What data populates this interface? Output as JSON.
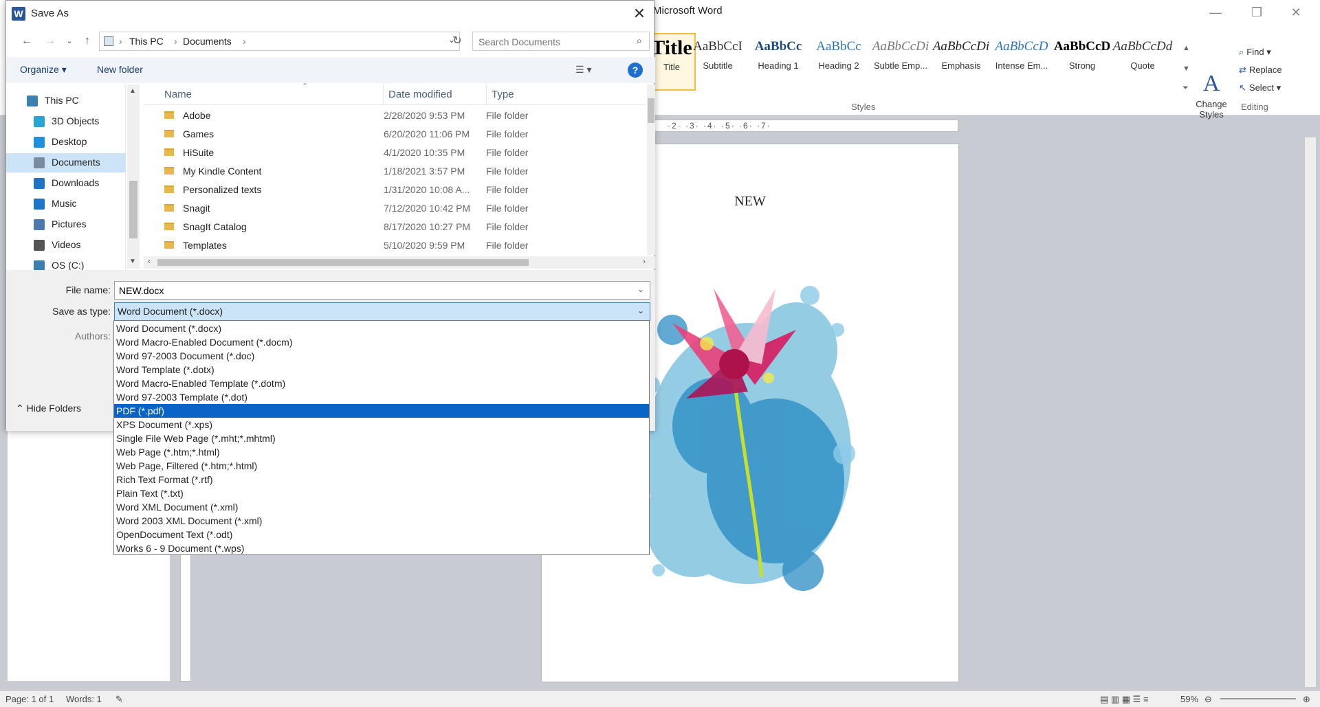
{
  "word": {
    "window_title": "Microsoft Word",
    "styles": [
      {
        "sample": "Title",
        "name": "Title"
      },
      {
        "sample": "AaBbCcI",
        "name": "Subtitle"
      },
      {
        "sample": "AaBbCc",
        "name": "Heading 1"
      },
      {
        "sample": "AaBbCc",
        "name": "Heading 2"
      },
      {
        "sample": "AaBbCcDi",
        "name": "Subtle Emp..."
      },
      {
        "sample": "AaBbCcDi",
        "name": "Emphasis"
      },
      {
        "sample": "AaBbCcD",
        "name": "Intense Em..."
      },
      {
        "sample": "AaBbCcD",
        "name": "Strong"
      },
      {
        "sample": "AaBbCcDd",
        "name": "Quote"
      }
    ],
    "change_styles_label": "Change Styles",
    "styles_group": "Styles",
    "editing": {
      "find": "Find",
      "replace": "Replace",
      "select": "Select",
      "group": "Editing"
    },
    "ruler_text": "·2·  ·3·  ·4·  ·5·  ·6·  ·7·",
    "document_text": "NEW",
    "status": {
      "page": "Page: 1 of 1",
      "words": "Words: 1",
      "zoom": "59%"
    }
  },
  "dialog": {
    "title": "Save As",
    "close_icon": "close-icon",
    "breadcrumb": [
      "This PC",
      "Documents"
    ],
    "search_placeholder": "Search Documents",
    "organize": "Organize",
    "new_folder": "New folder",
    "help": "?",
    "tree": [
      {
        "label": "This PC",
        "icon": "computer-icon",
        "color": "#3c7fb1"
      },
      {
        "label": "3D Objects",
        "icon": "cube-icon",
        "color": "#2aa4d6"
      },
      {
        "label": "Desktop",
        "icon": "desktop-icon",
        "color": "#1e90e0"
      },
      {
        "label": "Documents",
        "icon": "documents-icon",
        "color": "#7a8aa0",
        "selected": true
      },
      {
        "label": "Downloads",
        "icon": "download-icon",
        "color": "#1e74c8"
      },
      {
        "label": "Music",
        "icon": "music-icon",
        "color": "#1e74c8"
      },
      {
        "label": "Pictures",
        "icon": "pictures-icon",
        "color": "#4a7ab0"
      },
      {
        "label": "Videos",
        "icon": "videos-icon",
        "color": "#555555"
      },
      {
        "label": "OS (C:)",
        "icon": "drive-icon",
        "color": "#3c7fb1"
      }
    ],
    "columns": {
      "name": "Name",
      "date": "Date modified",
      "type": "Type"
    },
    "files": [
      {
        "name": "Adobe",
        "date": "2/28/2020 9:53 PM",
        "type": "File folder"
      },
      {
        "name": "Games",
        "date": "6/20/2020 11:06 PM",
        "type": "File folder"
      },
      {
        "name": "HiSuite",
        "date": "4/1/2020 10:35 PM",
        "type": "File folder"
      },
      {
        "name": "My Kindle Content",
        "date": "1/18/2021 3:57 PM",
        "type": "File folder"
      },
      {
        "name": "Personalized texts",
        "date": "1/31/2020 10:08 A...",
        "type": "File folder"
      },
      {
        "name": "Snagit",
        "date": "7/12/2020 10:42 PM",
        "type": "File folder"
      },
      {
        "name": "SnagIt Catalog",
        "date": "8/17/2020 10:27 PM",
        "type": "File folder"
      },
      {
        "name": "Templates",
        "date": "5/10/2020 9:59 PM",
        "type": "File folder"
      }
    ],
    "file_name_label": "File name:",
    "file_name_value": "NEW.docx",
    "save_as_type_label": "Save as type:",
    "save_as_type_value": "Word Document (*.docx)",
    "authors_label": "Authors:",
    "hide_folders": "Hide Folders",
    "type_options": [
      "Word Document (*.docx)",
      "Word Macro-Enabled Document (*.docm)",
      "Word 97-2003 Document (*.doc)",
      "Word Template (*.dotx)",
      "Word Macro-Enabled Template (*.dotm)",
      "Word 97-2003 Template (*.dot)",
      "PDF (*.pdf)",
      "XPS Document (*.xps)",
      "Single File Web Page (*.mht;*.mhtml)",
      "Web Page (*.htm;*.html)",
      "Web Page, Filtered (*.htm;*.html)",
      "Rich Text Format (*.rtf)",
      "Plain Text (*.txt)",
      "Word XML Document (*.xml)",
      "Word 2003 XML Document (*.xml)",
      "OpenDocument Text (*.odt)",
      "Works 6 - 9 Document (*.wps)"
    ],
    "highlighted_option": 6,
    "accent": "#0a64c8"
  }
}
